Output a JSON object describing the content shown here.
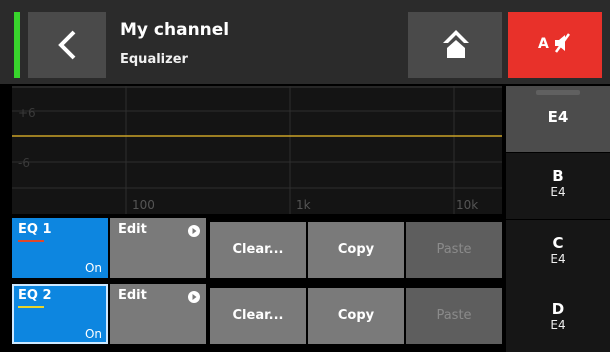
{
  "header": {
    "title": "My channel",
    "subtitle": "Equalizer",
    "mute_label": "A",
    "level_color": "#38d42c",
    "mute_color": "#e8312a",
    "icons": {
      "back": "chevron-left-icon",
      "home": "home-icon",
      "mute": "speaker-muted-icon"
    }
  },
  "graph": {
    "y_labels": [
      "+6",
      "-6"
    ],
    "x_labels": [
      "100",
      "1k",
      "10k"
    ],
    "curve_color": "#c9a227",
    "curve_level_db": 0
  },
  "eq_rows": [
    {
      "label": "EQ 1",
      "state": "On",
      "underline_color": "#e0482a",
      "edit": "Edit",
      "clear": "Clear...",
      "copy": "Copy",
      "paste": "Paste"
    },
    {
      "label": "EQ 2",
      "state": "On",
      "underline_color": "#e8d42a",
      "edit": "Edit",
      "clear": "Clear...",
      "copy": "Copy",
      "paste": "Paste"
    }
  ],
  "side": [
    {
      "name": "E4",
      "sub": ""
    },
    {
      "name": "B",
      "sub": "E4"
    },
    {
      "name": "C",
      "sub": "E4"
    },
    {
      "name": "D",
      "sub": "E4"
    }
  ]
}
